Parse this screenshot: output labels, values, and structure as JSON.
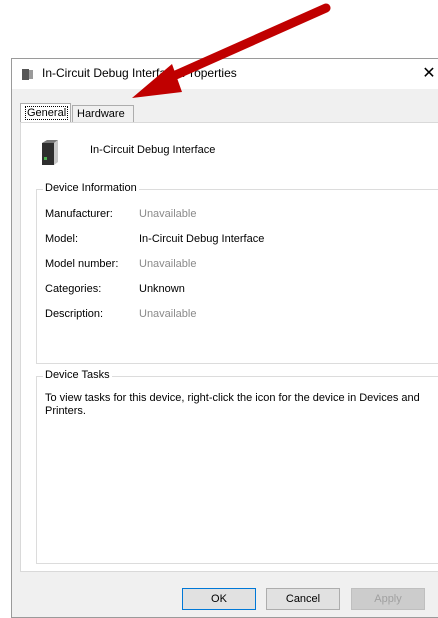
{
  "window": {
    "title": "In-Circuit Debug Interface Properties",
    "close_glyph": "✕"
  },
  "tabs": [
    {
      "label": "General",
      "selected": true
    },
    {
      "label": "Hardware",
      "selected": false
    }
  ],
  "device": {
    "name": "In-Circuit Debug Interface",
    "icon": "device-icon"
  },
  "device_information": {
    "title": "Device Information",
    "rows": [
      {
        "label": "Manufacturer:",
        "value": "Unavailable"
      },
      {
        "label": "Model:",
        "value": "In-Circuit Debug Interface"
      },
      {
        "label": "Model number:",
        "value": "Unavailable"
      },
      {
        "label": "Categories:",
        "value": "Unknown"
      },
      {
        "label": "Description:",
        "value": "Unavailable"
      }
    ]
  },
  "device_tasks": {
    "title": "Device Tasks",
    "text": "To view tasks for this device, right-click the icon for the device in Devices and Printers."
  },
  "buttons": {
    "ok": "OK",
    "cancel": "Cancel",
    "apply": "Apply"
  },
  "colors": {
    "annotation_arrow": "#c00000",
    "dim_text": "#8a8a8a",
    "accent_border": "#0078d7"
  }
}
